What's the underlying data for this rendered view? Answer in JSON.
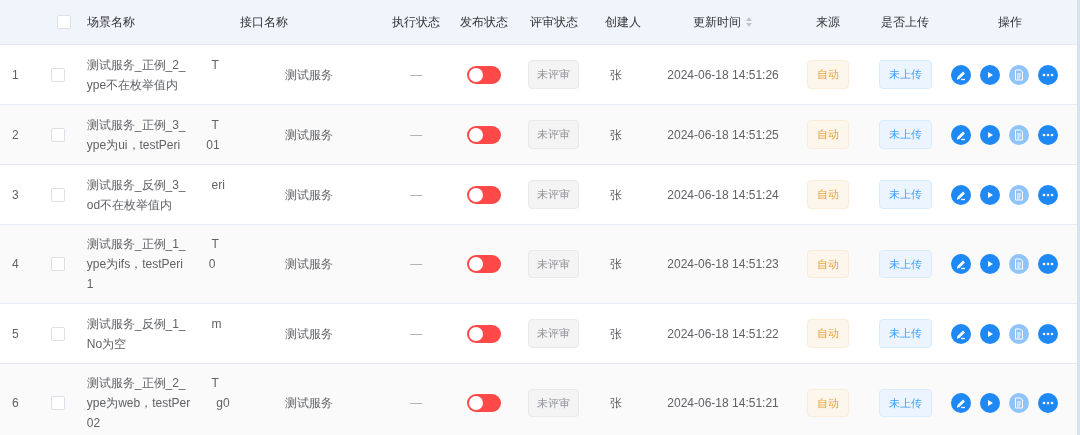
{
  "table": {
    "columns": [
      {
        "kind": "checkbox",
        "checked": false
      },
      {
        "label": "场景名称",
        "kind": "text"
      },
      {
        "label": "接口名称",
        "kind": "text"
      },
      {
        "label": "执行状态",
        "kind": "text"
      },
      {
        "label": "发布状态",
        "kind": "text"
      },
      {
        "label": "评审状态",
        "kind": "text"
      },
      {
        "label": "创建人",
        "kind": "text"
      },
      {
        "label": "更新时间",
        "kind": "sortable"
      },
      {
        "label": "来源",
        "kind": "text"
      },
      {
        "label": "是否上传",
        "kind": "text"
      },
      {
        "label": "操作",
        "kind": "text"
      }
    ],
    "rows": [
      {
        "index": "1",
        "checked": false,
        "name_lines": [
          [
            "测试服务_正例_2_",
            "T"
          ],
          [
            "ype不在枚举值内"
          ]
        ],
        "interface": "测试服务",
        "exec_status": "—",
        "published": false,
        "review": "未评审",
        "creator": "张",
        "updated": "2024-06-18 14:51:26",
        "source": "自动",
        "upload": "未上传",
        "actions": [
          {
            "kind": "edit",
            "enabled": true
          },
          {
            "kind": "run",
            "enabled": true
          },
          {
            "kind": "doc",
            "enabled": false
          },
          {
            "kind": "more",
            "enabled": true
          }
        ]
      },
      {
        "index": "2",
        "checked": false,
        "name_lines": [
          [
            "测试服务_正例_3_",
            "T"
          ],
          [
            "ype为ui，testPeri",
            "01"
          ]
        ],
        "interface": "测试服务",
        "exec_status": "—",
        "published": false,
        "review": "未评审",
        "creator": "张",
        "updated": "2024-06-18 14:51:25",
        "source": "自动",
        "upload": "未上传",
        "actions": [
          {
            "kind": "edit",
            "enabled": true
          },
          {
            "kind": "run",
            "enabled": true
          },
          {
            "kind": "doc",
            "enabled": false
          },
          {
            "kind": "more",
            "enabled": true
          }
        ]
      },
      {
        "index": "3",
        "checked": false,
        "name_lines": [
          [
            "测试服务_反例_3_",
            "eri"
          ],
          [
            "od不在枚举值内"
          ]
        ],
        "interface": "测试服务",
        "exec_status": "—",
        "published": false,
        "review": "未评审",
        "creator": "张",
        "updated": "2024-06-18 14:51:24",
        "source": "自动",
        "upload": "未上传",
        "actions": [
          {
            "kind": "edit",
            "enabled": true
          },
          {
            "kind": "run",
            "enabled": true
          },
          {
            "kind": "doc",
            "enabled": false
          },
          {
            "kind": "more",
            "enabled": true
          }
        ]
      },
      {
        "index": "4",
        "checked": false,
        "name_lines": [
          [
            "测试服务_正例_1_",
            "T"
          ],
          [
            "ype为ifs，testPeri",
            "0"
          ],
          [
            "1"
          ]
        ],
        "interface": "测试服务",
        "exec_status": "—",
        "published": false,
        "review": "未评审",
        "creator": "张",
        "updated": "2024-06-18 14:51:23",
        "source": "自动",
        "upload": "未上传",
        "actions": [
          {
            "kind": "edit",
            "enabled": true
          },
          {
            "kind": "run",
            "enabled": true
          },
          {
            "kind": "doc",
            "enabled": false
          },
          {
            "kind": "more",
            "enabled": true
          }
        ]
      },
      {
        "index": "5",
        "checked": false,
        "name_lines": [
          [
            "测试服务_反例_1_",
            "m"
          ],
          [
            "No为空"
          ]
        ],
        "interface": "测试服务",
        "exec_status": "—",
        "published": false,
        "review": "未评审",
        "creator": "张",
        "updated": "2024-06-18 14:51:22",
        "source": "自动",
        "upload": "未上传",
        "actions": [
          {
            "kind": "edit",
            "enabled": true
          },
          {
            "kind": "run",
            "enabled": true
          },
          {
            "kind": "doc",
            "enabled": false
          },
          {
            "kind": "more",
            "enabled": true
          }
        ]
      },
      {
        "index": "6",
        "checked": false,
        "name_lines": [
          [
            "测试服务_正例_2_",
            "T"
          ],
          [
            "ype为web，testPer",
            "g0"
          ],
          [
            "02"
          ]
        ],
        "interface": "测试服务",
        "exec_status": "—",
        "published": false,
        "review": "未评审",
        "creator": "张",
        "updated": "2024-06-18 14:51:21",
        "source": "自动",
        "upload": "未上传",
        "actions": [
          {
            "kind": "edit",
            "enabled": true
          },
          {
            "kind": "run",
            "enabled": true
          },
          {
            "kind": "doc",
            "enabled": false
          },
          {
            "kind": "more",
            "enabled": true
          }
        ]
      }
    ]
  }
}
